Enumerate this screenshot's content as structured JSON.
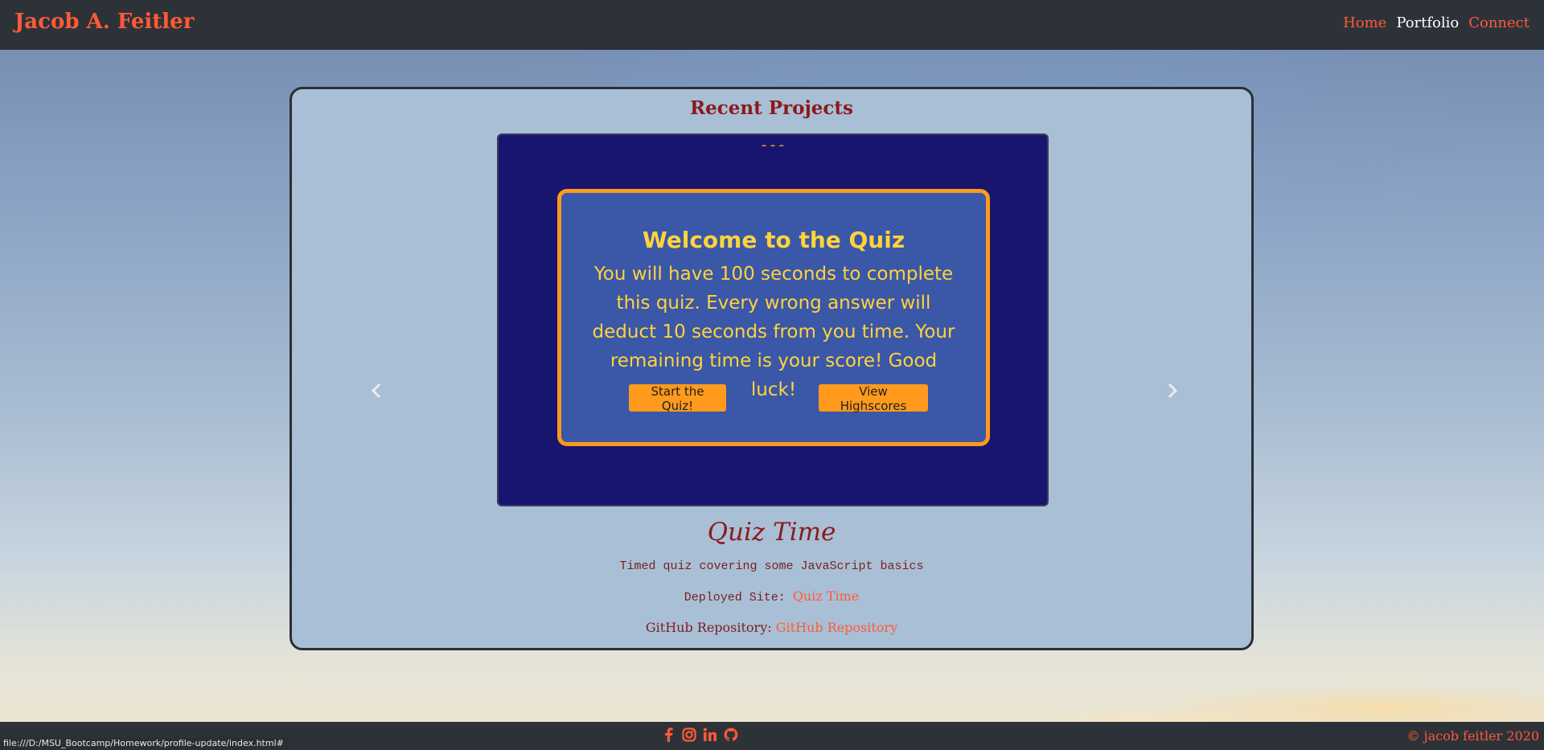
{
  "header": {
    "brand": "Jacob A. Feitler",
    "nav": [
      "Home",
      "Portfolio",
      "Connect"
    ],
    "active_nav": "Portfolio"
  },
  "main": {
    "title": "Recent Projects",
    "carousel": {
      "indicator": "---",
      "quiz_title": "Welcome to the Quiz",
      "quiz_text": "You will have 100 seconds to complete this quiz. Every wrong answer will deduct 10 seconds from you time. Your remaining time is your score! Good luck!",
      "start_button": "Start the Quiz!",
      "highscores_button": "View Highscores"
    },
    "project": {
      "name": "Quiz Time",
      "description": "Timed quiz covering some JavaScript basics",
      "deployed_label": "Deployed Site:",
      "deployed_link": "Quiz Time",
      "repo_label": "GitHub Repository:",
      "repo_link": "GitHub Repository"
    }
  },
  "footer": {
    "socials": [
      "facebook-icon",
      "instagram-icon",
      "linkedin-icon",
      "github-icon"
    ],
    "copyright": "© jacob feitler 2020"
  },
  "status_bar": {
    "url": "file:///D:/MSU_Bootcamp/Homework/profile-update/index.html#"
  },
  "colors": {
    "accent": "#ff5a36",
    "header_bg": "#2d3239",
    "card_bg": "#a9bfd6",
    "carousel_bg": "#18156e",
    "quiz_bg": "#3b57a8",
    "quiz_border": "#ff9a1c",
    "quiz_text": "#ffd43b"
  }
}
